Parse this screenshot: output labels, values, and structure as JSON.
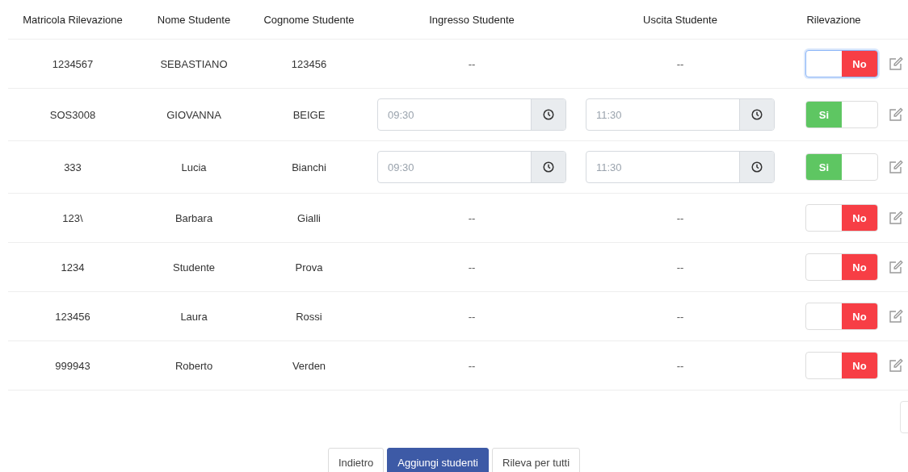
{
  "columns": [
    "Matricola Rilevazione",
    "Nome Studente",
    "Cognome Studente",
    "Ingresso Studente",
    "Uscita Studente",
    "Rilevazione"
  ],
  "rows": [
    {
      "matricola": "1234567",
      "nome": "SEBASTIANO",
      "cognome": "123456",
      "present": false,
      "focused": true,
      "entry": "--",
      "exit": "--",
      "toggle_label": "No"
    },
    {
      "matricola": "SOS3008",
      "nome": "GIOVANNA",
      "cognome": "BEIGE",
      "present": true,
      "focused": false,
      "entry": "09:30",
      "exit": "11:30",
      "toggle_label": "Si"
    },
    {
      "matricola": "333",
      "nome": "Lucia",
      "cognome": "Bianchi",
      "present": true,
      "focused": false,
      "entry": "09:30",
      "exit": "11:30",
      "toggle_label": "Si"
    },
    {
      "matricola": "123\\",
      "nome": "Barbara",
      "cognome": "Gialli",
      "present": false,
      "focused": false,
      "entry": "--",
      "exit": "--",
      "toggle_label": "No"
    },
    {
      "matricola": "1234",
      "nome": "Studente",
      "cognome": "Prova",
      "present": false,
      "focused": false,
      "entry": "--",
      "exit": "--",
      "toggle_label": "No"
    },
    {
      "matricola": "123456",
      "nome": "Laura",
      "cognome": "Rossi",
      "present": false,
      "focused": false,
      "entry": "--",
      "exit": "--",
      "toggle_label": "No"
    },
    {
      "matricola": "999943",
      "nome": "Roberto",
      "cognome": "Verden",
      "present": false,
      "focused": false,
      "entry": "--",
      "exit": "--",
      "toggle_label": "No"
    }
  ],
  "buttons": [
    {
      "label": "Indietro",
      "primary": false
    },
    {
      "label": "Aggiungi studenti",
      "primary": true
    },
    {
      "label": "Rileva per tutti",
      "primary": false
    }
  ]
}
